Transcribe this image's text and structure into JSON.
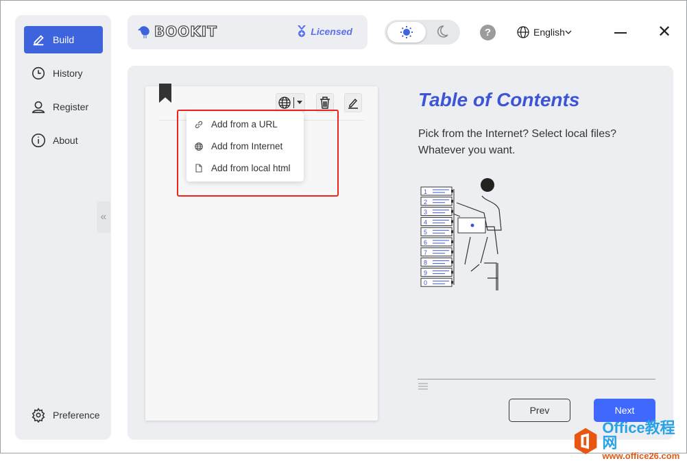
{
  "sidebar": {
    "items": [
      {
        "label": "Build",
        "icon": "pencil-icon",
        "active": true
      },
      {
        "label": "History",
        "icon": "clock-icon"
      },
      {
        "label": "Register",
        "icon": "user-icon"
      },
      {
        "label": "About",
        "icon": "info-icon"
      }
    ],
    "preference": "Preference",
    "collapse_glyph": "«"
  },
  "header": {
    "logo": "BOOKIT",
    "license": "Licensed",
    "help": "?",
    "language": "English",
    "theme": "light"
  },
  "editor": {
    "menu": [
      {
        "label": "Add from a URL",
        "icon": "link-icon"
      },
      {
        "label": "Add from Internet",
        "icon": "globe-icon"
      },
      {
        "label": "Add from local html",
        "icon": "file-icon"
      }
    ]
  },
  "panel": {
    "title": "Table of Contents",
    "description": "Pick from the Internet? Select local files? Whatever you want.",
    "illustration_labels": [
      "1",
      "2",
      "3",
      "4",
      "5",
      "6",
      "7",
      "8",
      "9",
      "0"
    ],
    "prev": "Prev",
    "next": "Next"
  },
  "watermark": {
    "line1": "Office教程网",
    "line2": "www.office26.com"
  },
  "colors": {
    "accent": "#3d63dd",
    "next": "#4068fc",
    "highlight": "#f0201a"
  }
}
